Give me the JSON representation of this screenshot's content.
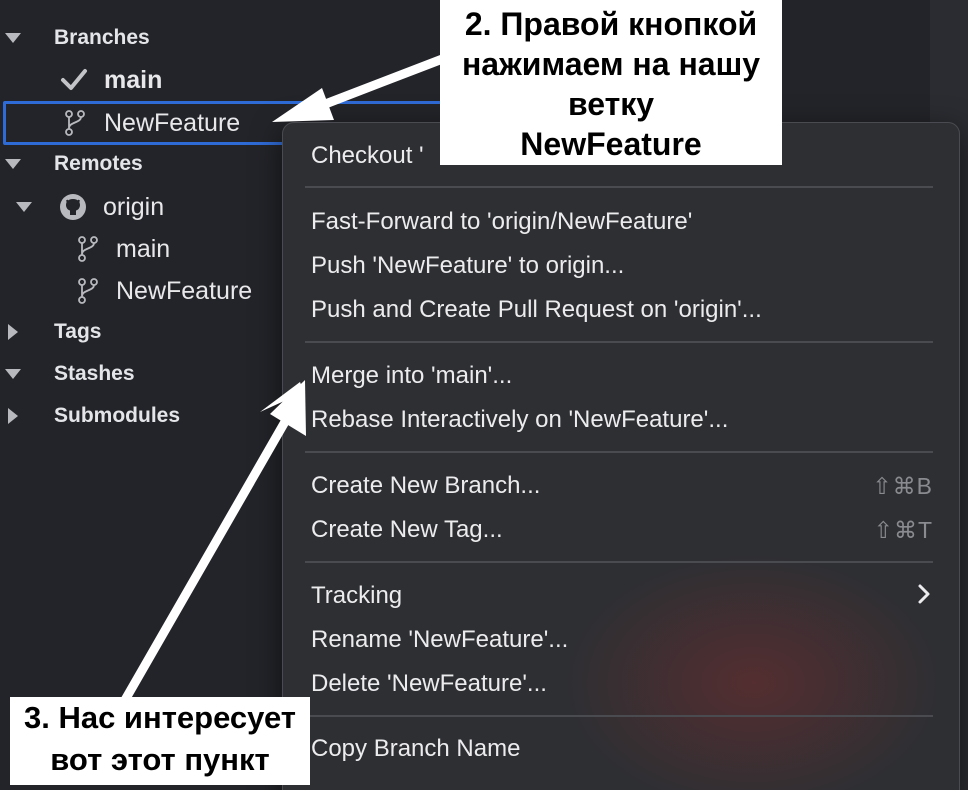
{
  "sidebar": {
    "sections": {
      "branches": "Branches",
      "remotes": "Remotes",
      "tags": "Tags",
      "stashes": "Stashes",
      "submodules": "Submodules"
    },
    "branches": {
      "current": "main",
      "selected": "NewFeature"
    },
    "remote": {
      "name": "origin",
      "branches": [
        "main",
        "NewFeature"
      ]
    }
  },
  "menu": {
    "checkout": "Checkout '",
    "fast_forward": "Fast-Forward to 'origin/NewFeature'",
    "push": "Push 'NewFeature' to origin...",
    "push_pr": "Push and Create Pull Request on 'origin'...",
    "merge": "Merge into 'main'...",
    "rebase": "Rebase Interactively on 'NewFeature'...",
    "new_branch": "Create New Branch...",
    "new_branch_shortcut": "⇧⌘B",
    "new_tag": "Create New Tag...",
    "new_tag_shortcut": "⇧⌘T",
    "tracking": "Tracking",
    "rename": "Rename 'NewFeature'...",
    "delete": "Delete 'NewFeature'...",
    "copy_name": "Copy Branch Name"
  },
  "annotations": {
    "step2": [
      "2. Правой кнопкой",
      "нажимаем на нашу",
      "ветку",
      "NewFeature"
    ],
    "step3": [
      "3. Нас интересует",
      "вот этот пункт"
    ]
  },
  "colors": {
    "background": "#232429",
    "menu_background": "#2e2f33",
    "selection_border": "#2f6bd6",
    "callout_background": "#ffffff",
    "arrow": "#ffffff"
  },
  "icons": {
    "branch": "git-branch-icon",
    "current_branch": "checkmark-icon",
    "remote": "github-icon",
    "submenu": "chevron-right-icon"
  }
}
